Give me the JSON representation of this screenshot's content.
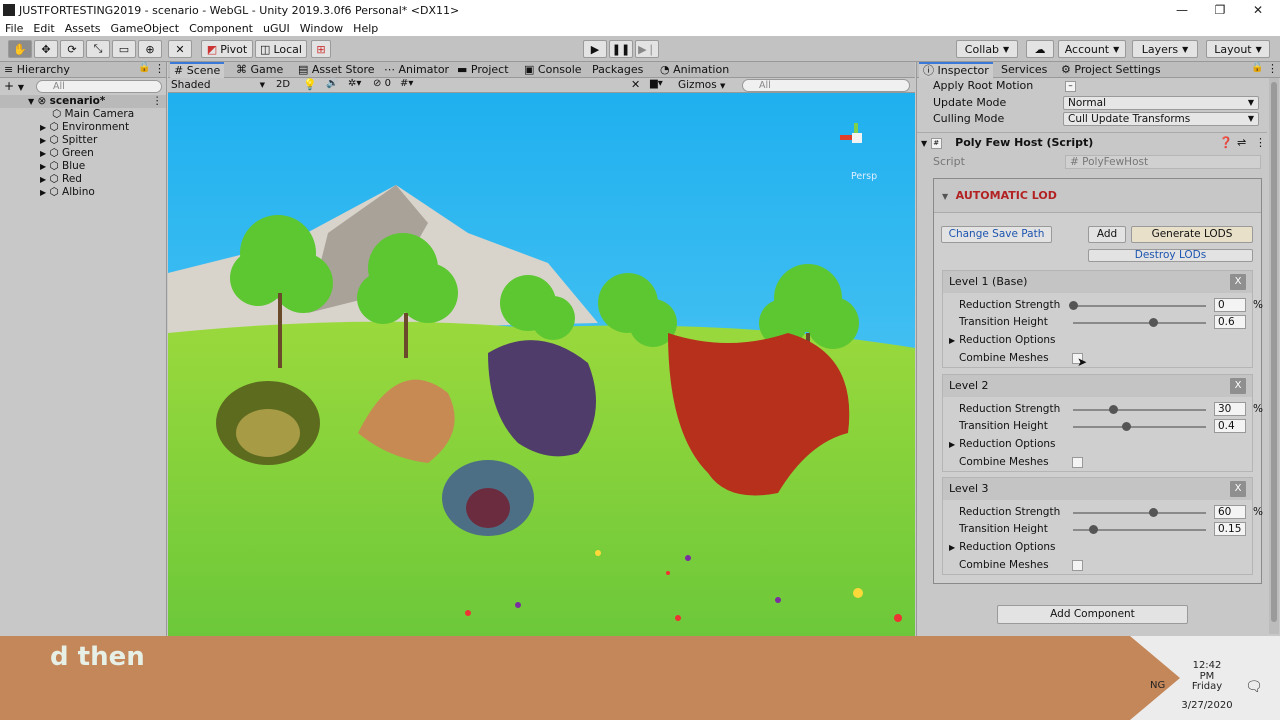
{
  "window": {
    "title": "JUSTFORTESTING2019 - scenario - WebGL - Unity 2019.3.0f6 Personal* <DX11>",
    "minimize": "—",
    "maximize": "❐",
    "close": "✕"
  },
  "menu": [
    "File",
    "Edit",
    "Assets",
    "GameObject",
    "Component",
    "uGUI",
    "Window",
    "Help"
  ],
  "toolbar": {
    "pivot_label": "Pivot",
    "local_label": "Local",
    "collab_label": "Collab",
    "account_label": "Account",
    "layers_label": "Layers",
    "layout_label": "Layout"
  },
  "hierarchy": {
    "tab": "Hierarchy",
    "search_placeholder": "All",
    "root": "scenario*",
    "items": [
      "Main Camera",
      "Environment",
      "Spitter",
      "Green",
      "Blue",
      "Red",
      "Albino"
    ]
  },
  "scene": {
    "tabs": [
      "Scene",
      "Game",
      "Asset Store",
      "Animator",
      "Project",
      "Console",
      "Packages",
      "Animation"
    ],
    "shading": "Shaded",
    "mode_2d": "2D",
    "fx_count": "0",
    "gizmos": "Gizmos",
    "search_placeholder": "All",
    "persp": "Persp"
  },
  "inspector": {
    "tabs": [
      "Inspector",
      "Services",
      "Project Settings"
    ],
    "apply_root_motion": "Apply Root Motion",
    "update_mode_label": "Update Mode",
    "update_mode_value": "Normal",
    "culling_mode_label": "Culling Mode",
    "culling_mode_value": "Cull Update Transforms",
    "component_title": "Poly Few Host (Script)",
    "script_label": "Script",
    "script_value": "PolyFewHost",
    "lod_header": "AUTOMATIC LOD",
    "change_save_path": "Change Save Path",
    "add": "Add",
    "generate_lods": "Generate LODS",
    "destroy_lods": "Destroy LODs",
    "reduction_strength_label": "Reduction Strength",
    "transition_height_label": "Transition Height",
    "reduction_options_label": "Reduction Options",
    "combine_meshes_label": "Combine Meshes",
    "percent": "%",
    "close_label": "X",
    "levels": [
      {
        "title": "Level 1 (Base)",
        "reduction": "0",
        "reduction_frac": 0.0,
        "height": "0.6",
        "height_frac": 0.6
      },
      {
        "title": "Level 2",
        "reduction": "30",
        "reduction_frac": 0.3,
        "height": "0.4",
        "height_frac": 0.4
      },
      {
        "title": "Level 3",
        "reduction": "60",
        "reduction_frac": 0.6,
        "height": "0.15",
        "height_frac": 0.15
      }
    ],
    "add_component": "Add Component"
  },
  "caption": "d then",
  "taskbar": {
    "time": "12:42 PM",
    "day": "Friday",
    "date": "3/27/2020",
    "lang": "NG"
  },
  "colors": {
    "accent": "#3a79d8",
    "lod_header": "#b22222",
    "banner": "#c4875a",
    "sky": "#2bb4f0",
    "grass": "#7bd63c"
  }
}
